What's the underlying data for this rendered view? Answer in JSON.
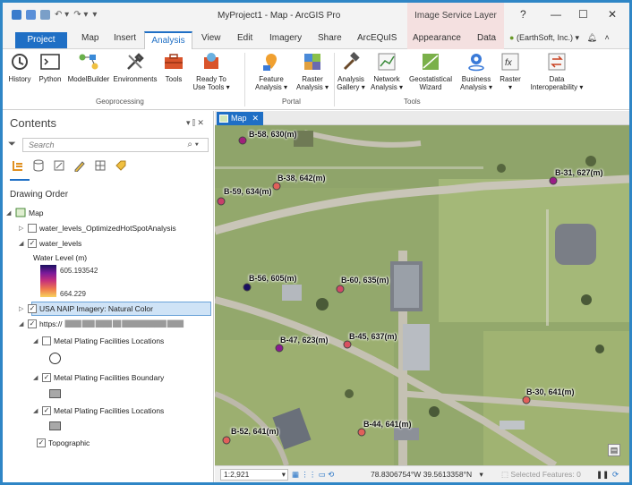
{
  "title_bar": {
    "app_title": "MyProject1 - Map - ArcGIS Pro",
    "contextual_tab_group": "Image Service Layer",
    "help": "?",
    "minimize": "—",
    "maximize": "☐",
    "close": "✕"
  },
  "ribbon_tabs": {
    "project": "Project",
    "map": "Map",
    "insert": "Insert",
    "analysis": "Analysis",
    "view": "View",
    "edit": "Edit",
    "imagery": "Imagery",
    "share": "Share",
    "arcequis": "ArcEQuIS",
    "appearance": "Appearance",
    "data": "Data",
    "user": "(EarthSoft, Inc.) ▾"
  },
  "ribbon": {
    "geoprocessing": {
      "history": "History",
      "python": "Python",
      "modelbuilder": "ModelBuilder",
      "environments": "Environments",
      "tools": "Tools",
      "ready_to_use_1": "Ready To",
      "ready_to_use_2": "Use Tools ▾",
      "group_label": "Geoprocessing"
    },
    "portal": {
      "feature_analysis_1": "Feature",
      "feature_analysis_2": "Analysis ▾",
      "raster_analysis_1": "Raster",
      "raster_analysis_2": "Analysis ▾",
      "group_label": "Portal"
    },
    "tools": {
      "analysis_gallery_1": "Analysis",
      "analysis_gallery_2": "Gallery ▾",
      "network_analysis_1": "Network",
      "network_analysis_2": "Analysis ▾",
      "geostat_1": "Geostatistical",
      "geostat_2": "Wizard",
      "business_1": "Business",
      "business_2": "Analysis ▾",
      "raster_1": "Raster",
      "raster_2": "▾",
      "data_interop_1": "Data",
      "data_interop_2": "Interoperability ▾",
      "group_label": "Tools"
    }
  },
  "contents": {
    "title": "Contents",
    "pin_controls": "▾ ⫿ ✕",
    "search_placeholder": "Search",
    "drawing_order": "Drawing Order",
    "layers": {
      "map": "Map",
      "hotspot": "water_levels_OptimizedHotSpotAnalysis",
      "water_levels": "water_levels",
      "water_level_title": "Water Level (m)",
      "legend_max": "605.193542",
      "legend_min": "664.229",
      "naip": "USA NAIP Imagery: Natural Color",
      "service": "https://",
      "service_redacted": "████ ███ ████ ██ ███████████ ████",
      "mpf_locations_1": "Metal Plating Facilities Locations",
      "mpf_boundary": "Metal Plating Facilities Boundary",
      "mpf_locations_2": "Metal Plating Facilities Locations",
      "topographic": "Topographic"
    }
  },
  "map_view": {
    "tab_label": "Map",
    "points": [
      {
        "label": "B-58, 630(m)",
        "color": "#a0207a"
      },
      {
        "label": "B-38, 642(m)",
        "color": "#e0605a"
      },
      {
        "label": "B-59, 634(m)",
        "color": "#c8406a"
      },
      {
        "label": "B-31, 627(m)",
        "color": "#9a1c86"
      },
      {
        "label": "B-56, 605(m)",
        "color": "#1a1060"
      },
      {
        "label": "B-60, 635(m)",
        "color": "#d04a66"
      },
      {
        "label": "B-47, 623(m)",
        "color": "#8a1a90"
      },
      {
        "label": "B-45, 637(m)",
        "color": "#d85060"
      },
      {
        "label": "B-30, 641(m)",
        "color": "#e0605a"
      },
      {
        "label": "B-52, 641(m)",
        "color": "#e0605a"
      },
      {
        "label": "B-44, 641(m)",
        "color": "#e0605a"
      }
    ]
  },
  "status_bar": {
    "scale": "1:2,921",
    "coordinates": "78.8306754°W 39.5613358°N",
    "selected_features": "Selected Features: 0"
  }
}
